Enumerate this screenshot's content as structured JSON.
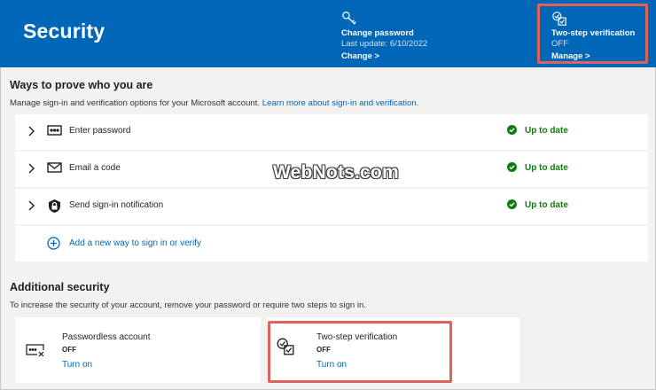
{
  "header": {
    "title": "Security",
    "change_password": {
      "title": "Change password",
      "sub": "Last update: 6/10/2022",
      "link": "Change >"
    },
    "two_step": {
      "title": "Two-step verification",
      "status": "OFF",
      "link": "Manage >"
    }
  },
  "ways": {
    "title": "Ways to prove who you are",
    "desc": "Manage sign-in and verification options for your Microsoft account.",
    "desc_link": "Learn more about sign-in and verification.",
    "items": [
      {
        "label": "Enter password",
        "status": "Up to date"
      },
      {
        "label": "Email a code",
        "status": "Up to date"
      },
      {
        "label": "Send sign-in notification",
        "status": "Up to date"
      }
    ],
    "add": "Add a new way to sign in or verify"
  },
  "additional": {
    "title": "Additional security",
    "desc": "To increase the security of your account, remove your password or require two steps to sign in.",
    "passwordless": {
      "title": "Passwordless account",
      "status": "OFF",
      "link": "Turn on"
    },
    "two_step": {
      "title": "Two-step verification",
      "status": "OFF",
      "link": "Turn on"
    }
  },
  "watermark": "WebNots.com",
  "colors": {
    "brand": "#0067b8",
    "success": "#107c10",
    "highlight": "#e0605a"
  }
}
